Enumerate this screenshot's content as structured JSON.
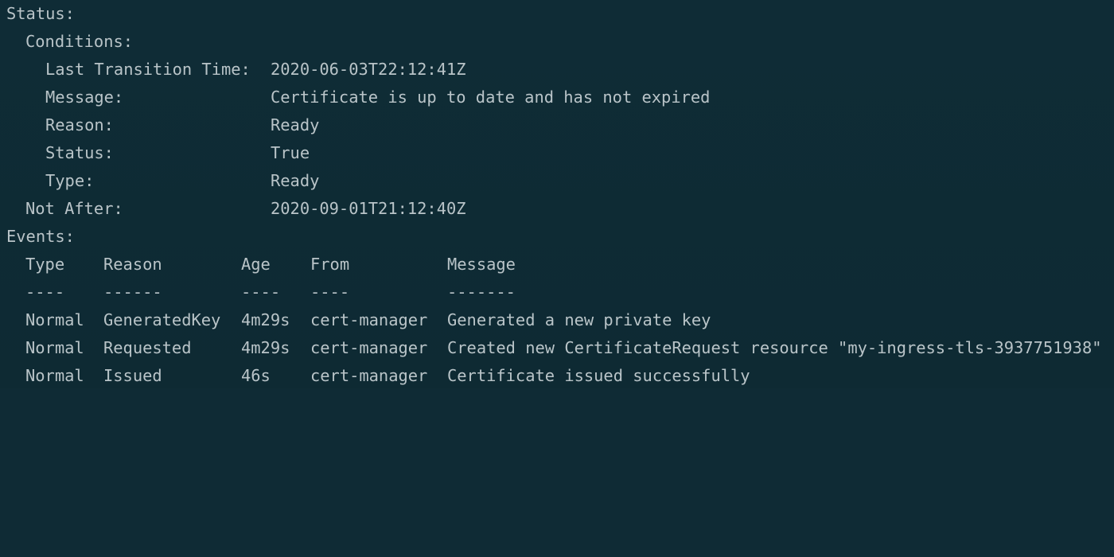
{
  "status": {
    "title": "Status:",
    "conditions_label": "Conditions:",
    "condition": {
      "last_transition_time_label": "Last Transition Time:",
      "last_transition_time_value": "2020-06-03T22:12:41Z",
      "message_label": "Message:",
      "message_value": "Certificate is up to date and has not expired",
      "reason_label": "Reason:",
      "reason_value": "Ready",
      "status_label": "Status:",
      "status_value": "True",
      "type_label": "Type:",
      "type_value": "Ready"
    },
    "not_after_label": "Not After:",
    "not_after_value": "2020-09-01T21:12:40Z"
  },
  "events": {
    "title": "Events:",
    "headers": {
      "type": "Type",
      "reason": "Reason",
      "age": "Age",
      "from": "From",
      "message": "Message"
    },
    "separators": {
      "type": "----",
      "reason": "------",
      "age": "----",
      "from": "----",
      "message": "-------"
    },
    "rows": [
      {
        "type": "Normal",
        "reason": "GeneratedKey",
        "age": "4m29s",
        "from": "cert-manager",
        "message": "Generated a new private key"
      },
      {
        "type": "Normal",
        "reason": "Requested",
        "age": "4m29s",
        "from": "cert-manager",
        "message": "Created new CertificateRequest resource \"my-ingress-tls-3937751938\""
      },
      {
        "type": "Normal",
        "reason": "Issued",
        "age": "46s",
        "from": "cert-manager",
        "message": "Certificate issued successfully"
      }
    ]
  }
}
